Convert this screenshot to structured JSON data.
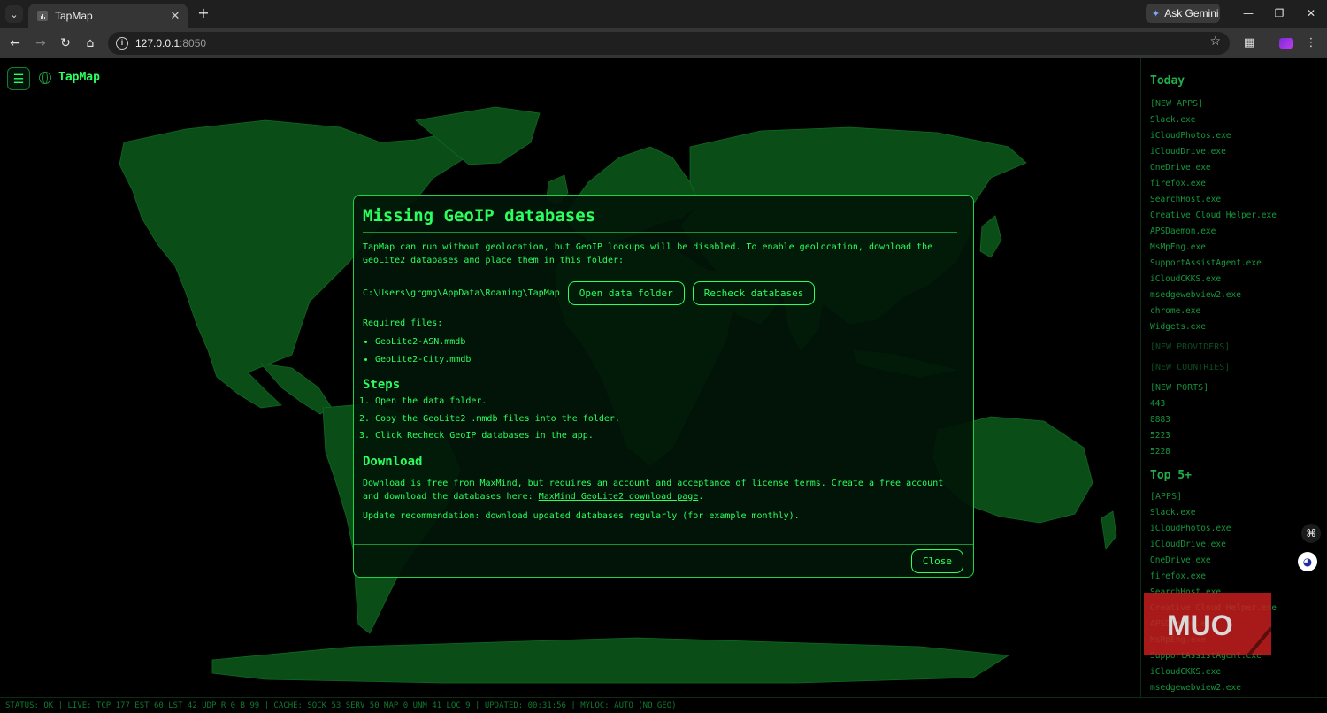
{
  "browser": {
    "tab_title": "TapMap",
    "url_host": "127.0.0.1",
    "url_port": ":8050",
    "ask_gemini": "Ask Gemini"
  },
  "app": {
    "brand": "TapMap"
  },
  "modal": {
    "title": "Missing GeoIP databases",
    "intro": "TapMap can run without geolocation, but GeoIP lookups will be disabled. To enable geolocation, download the GeoLite2 databases and place them in this folder:",
    "folder_path": "C:\\Users\\grgmg\\AppData\\Roaming\\TapMap",
    "open_folder_label": "Open data folder",
    "recheck_label": "Recheck databases",
    "required_label": "Required files:",
    "required_files": [
      "GeoLite2-ASN.mmdb",
      "GeoLite2-City.mmdb"
    ],
    "steps_heading": "Steps",
    "steps": [
      "Open the data folder.",
      "Copy the GeoLite2 .mmdb files into the folder.",
      "Click Recheck GeoIP databases in the app."
    ],
    "download_heading": "Download",
    "download_text_before": "Download is free from MaxMind, but requires an account and acceptance of license terms. Create a free account and download the databases here: ",
    "download_link": "MaxMind GeoLite2 download page",
    "download_text_after": ".",
    "update_note": "Update recommendation: download updated databases regularly (for example monthly).",
    "close_label": "Close"
  },
  "panel": {
    "today_heading": "Today",
    "new_apps_label": "[NEW APPS]",
    "new_apps": [
      "Slack.exe",
      "iCloudPhotos.exe",
      "iCloudDrive.exe",
      "OneDrive.exe",
      "firefox.exe",
      "SearchHost.exe",
      "Creative Cloud Helper.exe",
      "APSDaemon.exe",
      "MsMpEng.exe",
      "SupportAssistAgent.exe",
      "iCloudCKKS.exe",
      "msedgewebview2.exe",
      "chrome.exe",
      "Widgets.exe"
    ],
    "new_providers_label": "[NEW PROVIDERS]",
    "new_countries_label": "[NEW COUNTRIES]",
    "new_ports_label": "[NEW PORTS]",
    "new_ports": [
      "443",
      "8883",
      "5223",
      "5228"
    ],
    "top_heading": "Top 5+",
    "apps_label": "[APPS]",
    "top_apps": [
      "Slack.exe",
      "iCloudPhotos.exe",
      "iCloudDrive.exe",
      "OneDrive.exe",
      "firefox.exe",
      "SearchHost.exe",
      "Creative Cloud Helper.exe",
      "APSDaemon.exe",
      "MsMpEng.exe",
      "SupportAssistAgent.exe",
      "iCloudCKKS.exe",
      "msedgewebview2.exe"
    ]
  },
  "watermark": "MUO",
  "status_bar": "STATUS: OK | LIVE: TCP 177 EST 60 LST 42 UDP R 0 B 99 | CACHE: SOCK 53 SERV 50 MAP 0 UNM 41 LOC 9 | UPDATED: 00:31:56 | MYLOC: AUTO (NO GEO)",
  "colors": {
    "accent": "#2bff5e",
    "land": "#0b4d17",
    "background": "#000000"
  }
}
